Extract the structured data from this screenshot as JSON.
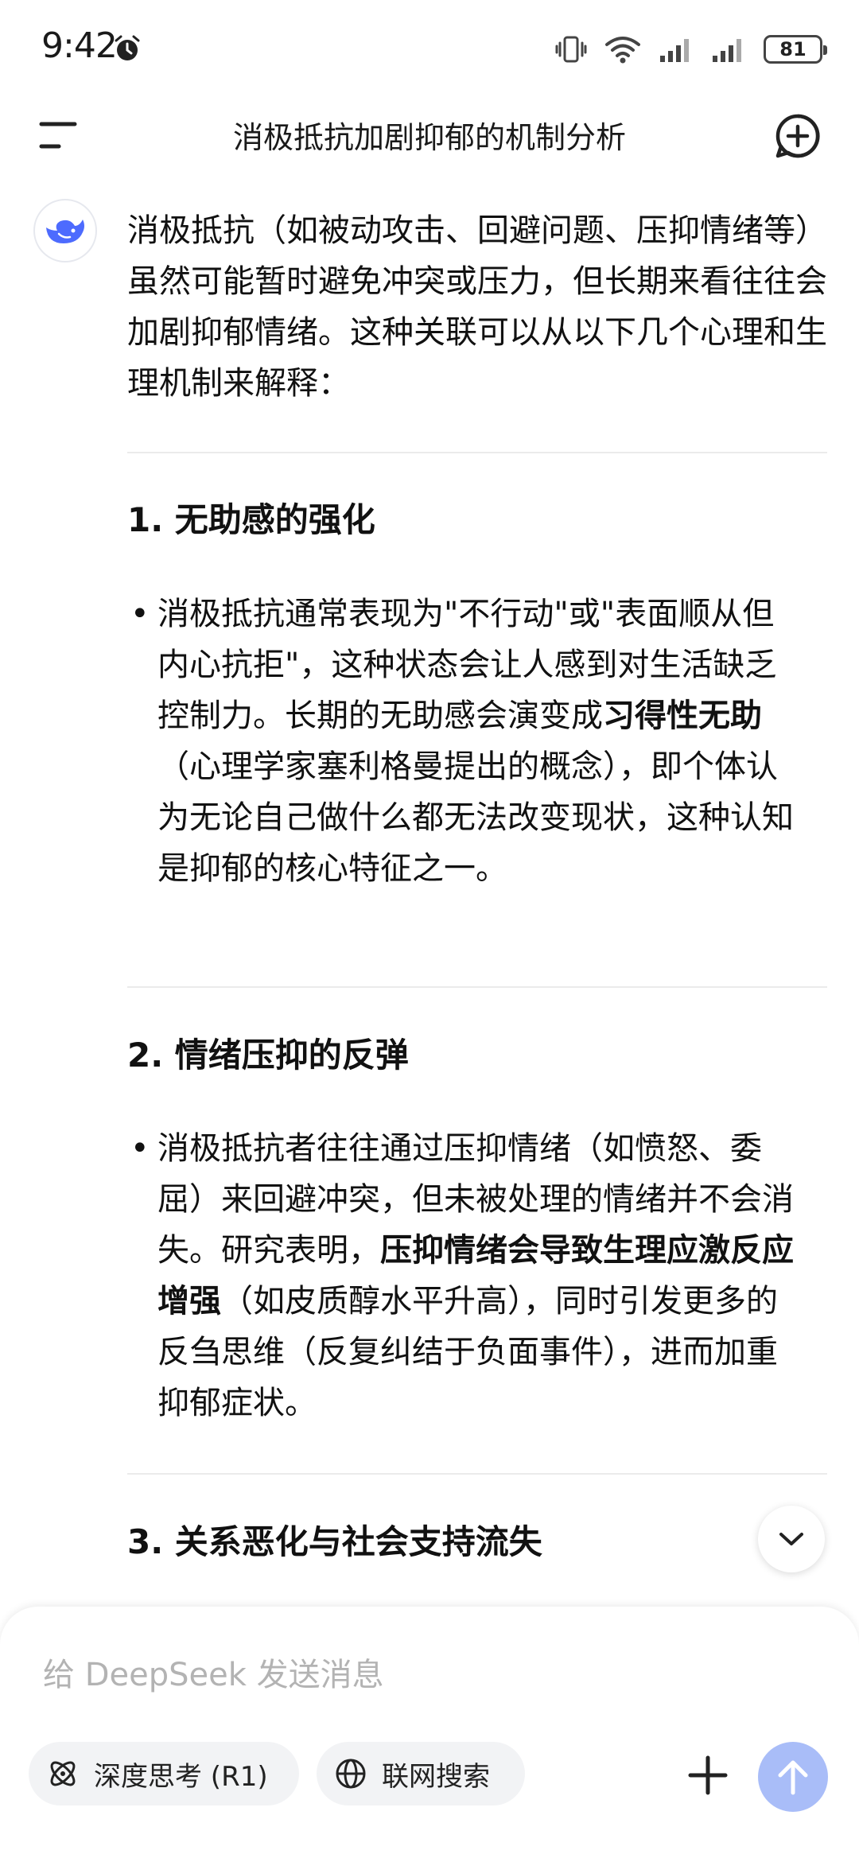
{
  "status_bar": {
    "time": "9:42",
    "battery": "81",
    "icons": [
      "alarm-icon",
      "vibrate-icon",
      "wifi-icon",
      "signal-icon",
      "signal-icon",
      "battery-icon"
    ]
  },
  "header": {
    "title": "消极抵抗加剧抑郁的机制分析",
    "icons": [
      "menu-icon",
      "new-chat-icon"
    ]
  },
  "message": {
    "avatar_icon": "deepseek-whale-icon",
    "intro": "消极抵抗（如被动攻击、回避问题、压抑情绪等）虽然可能暂时避免冲突或压力，但长期来看往往会加剧抑郁情绪。这种关联可以从以下几个心理和生理机制来解释：",
    "sections": [
      {
        "title": "1. 无助感的强化",
        "bullet_part1": "消极抵抗通常表现为\"不行动\"或\"表面顺从但内心抗拒\"，这种状态会让人感到对生活缺乏控制力。长期的无助感会演变成",
        "bullet_bold": "习得性无助",
        "bullet_part2": "（心理学家塞利格曼提出的概念），即个体认为无论自己做什么都无法改变现状，这种认知是抑郁的核心特征之一。"
      },
      {
        "title": "2. 情绪压抑的反弹",
        "bullet_part1": "消极抵抗者往往通过压抑情绪（如愤怒、委屈）来回避冲突，但未被处理的情绪并不会消失。研究表明，",
        "bullet_bold": "压抑情绪会导致生理应激反应增强",
        "bullet_part2": "（如皮质醇水平升高），同时引发更多的反刍思维（反复纠结于负面事件），进而加重抑郁症状。"
      },
      {
        "title": "3. 关系恶化与社会支持流失"
      }
    ],
    "bullet_symbol": "•"
  },
  "composer": {
    "placeholder": "给 DeepSeek 发送消息",
    "deep_think_label": "深度思考 (R1)",
    "web_search_label": "联网搜索",
    "accent_color": "#a9bdf8"
  }
}
